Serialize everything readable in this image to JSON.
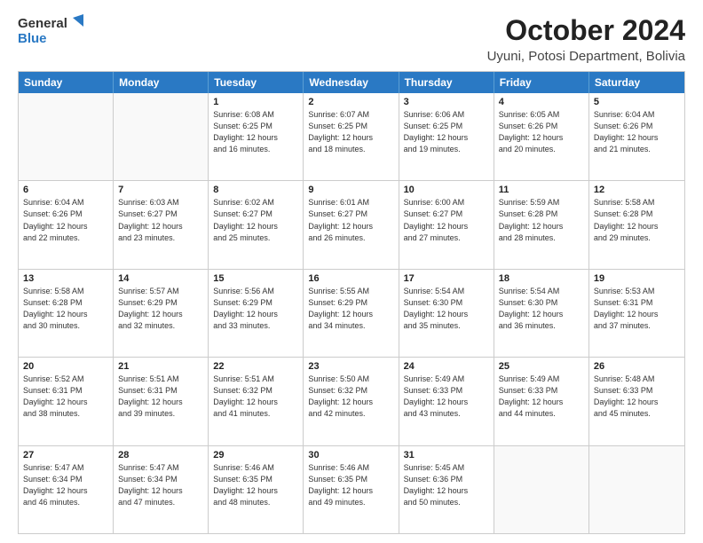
{
  "logo": {
    "general": "General",
    "blue": "Blue"
  },
  "title": "October 2024",
  "subtitle": "Uyuni, Potosi Department, Bolivia",
  "header_days": [
    "Sunday",
    "Monday",
    "Tuesday",
    "Wednesday",
    "Thursday",
    "Friday",
    "Saturday"
  ],
  "weeks": [
    [
      {
        "day": "",
        "info": ""
      },
      {
        "day": "",
        "info": ""
      },
      {
        "day": "1",
        "info": "Sunrise: 6:08 AM\nSunset: 6:25 PM\nDaylight: 12 hours\nand 16 minutes."
      },
      {
        "day": "2",
        "info": "Sunrise: 6:07 AM\nSunset: 6:25 PM\nDaylight: 12 hours\nand 18 minutes."
      },
      {
        "day": "3",
        "info": "Sunrise: 6:06 AM\nSunset: 6:25 PM\nDaylight: 12 hours\nand 19 minutes."
      },
      {
        "day": "4",
        "info": "Sunrise: 6:05 AM\nSunset: 6:26 PM\nDaylight: 12 hours\nand 20 minutes."
      },
      {
        "day": "5",
        "info": "Sunrise: 6:04 AM\nSunset: 6:26 PM\nDaylight: 12 hours\nand 21 minutes."
      }
    ],
    [
      {
        "day": "6",
        "info": "Sunrise: 6:04 AM\nSunset: 6:26 PM\nDaylight: 12 hours\nand 22 minutes."
      },
      {
        "day": "7",
        "info": "Sunrise: 6:03 AM\nSunset: 6:27 PM\nDaylight: 12 hours\nand 23 minutes."
      },
      {
        "day": "8",
        "info": "Sunrise: 6:02 AM\nSunset: 6:27 PM\nDaylight: 12 hours\nand 25 minutes."
      },
      {
        "day": "9",
        "info": "Sunrise: 6:01 AM\nSunset: 6:27 PM\nDaylight: 12 hours\nand 26 minutes."
      },
      {
        "day": "10",
        "info": "Sunrise: 6:00 AM\nSunset: 6:27 PM\nDaylight: 12 hours\nand 27 minutes."
      },
      {
        "day": "11",
        "info": "Sunrise: 5:59 AM\nSunset: 6:28 PM\nDaylight: 12 hours\nand 28 minutes."
      },
      {
        "day": "12",
        "info": "Sunrise: 5:58 AM\nSunset: 6:28 PM\nDaylight: 12 hours\nand 29 minutes."
      }
    ],
    [
      {
        "day": "13",
        "info": "Sunrise: 5:58 AM\nSunset: 6:28 PM\nDaylight: 12 hours\nand 30 minutes."
      },
      {
        "day": "14",
        "info": "Sunrise: 5:57 AM\nSunset: 6:29 PM\nDaylight: 12 hours\nand 32 minutes."
      },
      {
        "day": "15",
        "info": "Sunrise: 5:56 AM\nSunset: 6:29 PM\nDaylight: 12 hours\nand 33 minutes."
      },
      {
        "day": "16",
        "info": "Sunrise: 5:55 AM\nSunset: 6:29 PM\nDaylight: 12 hours\nand 34 minutes."
      },
      {
        "day": "17",
        "info": "Sunrise: 5:54 AM\nSunset: 6:30 PM\nDaylight: 12 hours\nand 35 minutes."
      },
      {
        "day": "18",
        "info": "Sunrise: 5:54 AM\nSunset: 6:30 PM\nDaylight: 12 hours\nand 36 minutes."
      },
      {
        "day": "19",
        "info": "Sunrise: 5:53 AM\nSunset: 6:31 PM\nDaylight: 12 hours\nand 37 minutes."
      }
    ],
    [
      {
        "day": "20",
        "info": "Sunrise: 5:52 AM\nSunset: 6:31 PM\nDaylight: 12 hours\nand 38 minutes."
      },
      {
        "day": "21",
        "info": "Sunrise: 5:51 AM\nSunset: 6:31 PM\nDaylight: 12 hours\nand 39 minutes."
      },
      {
        "day": "22",
        "info": "Sunrise: 5:51 AM\nSunset: 6:32 PM\nDaylight: 12 hours\nand 41 minutes."
      },
      {
        "day": "23",
        "info": "Sunrise: 5:50 AM\nSunset: 6:32 PM\nDaylight: 12 hours\nand 42 minutes."
      },
      {
        "day": "24",
        "info": "Sunrise: 5:49 AM\nSunset: 6:33 PM\nDaylight: 12 hours\nand 43 minutes."
      },
      {
        "day": "25",
        "info": "Sunrise: 5:49 AM\nSunset: 6:33 PM\nDaylight: 12 hours\nand 44 minutes."
      },
      {
        "day": "26",
        "info": "Sunrise: 5:48 AM\nSunset: 6:33 PM\nDaylight: 12 hours\nand 45 minutes."
      }
    ],
    [
      {
        "day": "27",
        "info": "Sunrise: 5:47 AM\nSunset: 6:34 PM\nDaylight: 12 hours\nand 46 minutes."
      },
      {
        "day": "28",
        "info": "Sunrise: 5:47 AM\nSunset: 6:34 PM\nDaylight: 12 hours\nand 47 minutes."
      },
      {
        "day": "29",
        "info": "Sunrise: 5:46 AM\nSunset: 6:35 PM\nDaylight: 12 hours\nand 48 minutes."
      },
      {
        "day": "30",
        "info": "Sunrise: 5:46 AM\nSunset: 6:35 PM\nDaylight: 12 hours\nand 49 minutes."
      },
      {
        "day": "31",
        "info": "Sunrise: 5:45 AM\nSunset: 6:36 PM\nDaylight: 12 hours\nand 50 minutes."
      },
      {
        "day": "",
        "info": ""
      },
      {
        "day": "",
        "info": ""
      }
    ]
  ]
}
